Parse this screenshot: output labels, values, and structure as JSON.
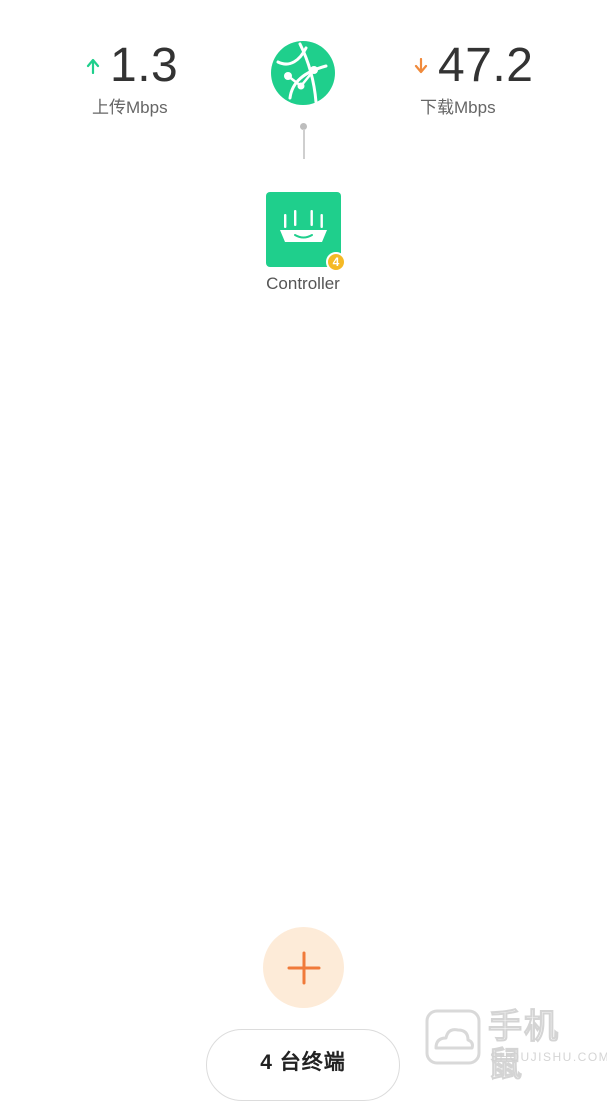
{
  "stats": {
    "upload": {
      "value": "1.3",
      "label": "上传Mbps",
      "arrow_icon": "arrow-up-icon",
      "color": "#1fcf8c"
    },
    "download": {
      "value": "47.2",
      "label": "下载Mbps",
      "arrow_icon": "arrow-down-icon",
      "color": "#f08a3c"
    }
  },
  "network": {
    "globe_icon": "globe-icon",
    "globe_color": "#1fcf8c"
  },
  "router": {
    "icon": "router-icon",
    "name": "Controller",
    "badge_count": "4",
    "card_color": "#1fcf8c",
    "badge_color": "#f5b925"
  },
  "add_button": {
    "icon": "plus-icon",
    "accent": "#f07a3a",
    "background": "#fdebd8"
  },
  "terminals": {
    "label": "4 台终端"
  },
  "watermark": {
    "title": "手机鼠",
    "subtitle": "SHOUJISHU.COM"
  }
}
